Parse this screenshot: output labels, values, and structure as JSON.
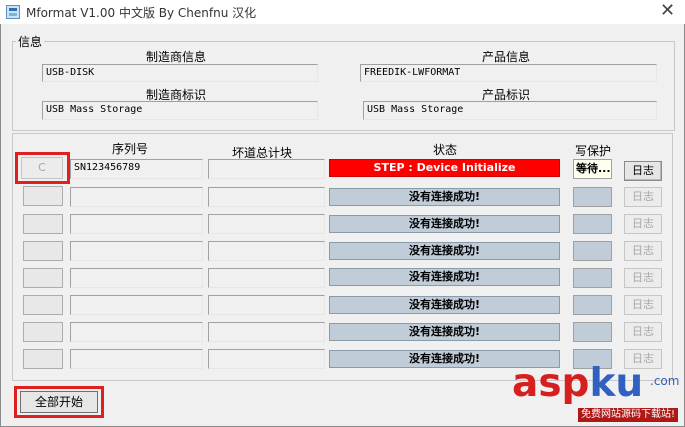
{
  "window": {
    "title": "Mformat V1.00 中文版 By Chenfnu 汉化",
    "close_symbol": "✕"
  },
  "info": {
    "legend": "信息",
    "vendor_info_label": "制造商信息",
    "vendor_info_value": "USB-DISK",
    "product_info_label": "产品信息",
    "product_info_value": "FREEDIK-LWFORMAT",
    "vendor_id_label": "制造商标识",
    "vendor_id_value": "USB Mass Storage",
    "product_id_label": "产品标识",
    "product_id_value": "USB Mass Storage"
  },
  "table": {
    "headers": {
      "serial": "序列号",
      "bad_blocks": "坏道总计块",
      "status": "状态",
      "write_protect": "写保护"
    },
    "rows": [
      {
        "slot": "C",
        "serial": "SN123456789",
        "bad": "",
        "status": "STEP : Device Initialize",
        "wp": "等待...",
        "log": "日志",
        "active": true
      },
      {
        "slot": "",
        "serial": "",
        "bad": "",
        "status": "没有连接成功!",
        "wp": "",
        "log": "日志",
        "active": false
      },
      {
        "slot": "",
        "serial": "",
        "bad": "",
        "status": "没有连接成功!",
        "wp": "",
        "log": "日志",
        "active": false
      },
      {
        "slot": "",
        "serial": "",
        "bad": "",
        "status": "没有连接成功!",
        "wp": "",
        "log": "日志",
        "active": false
      },
      {
        "slot": "",
        "serial": "",
        "bad": "",
        "status": "没有连接成功!",
        "wp": "",
        "log": "日志",
        "active": false
      },
      {
        "slot": "",
        "serial": "",
        "bad": "",
        "status": "没有连接成功!",
        "wp": "",
        "log": "日志",
        "active": false
      },
      {
        "slot": "",
        "serial": "",
        "bad": "",
        "status": "没有连接成功!",
        "wp": "",
        "log": "日志",
        "active": false
      },
      {
        "slot": "",
        "serial": "",
        "bad": "",
        "status": "没有连接成功!",
        "wp": "",
        "log": "日志",
        "active": false
      }
    ]
  },
  "start_all_label": "全部开始",
  "watermark": {
    "part_a": "asp",
    "part_b": "ku",
    "dot_com": ".com",
    "sub": "免费网站源码下载站!"
  },
  "colors": {
    "status_active": "#ff0000",
    "status_idle": "#c0ccd8",
    "highlight_box": "#e02020"
  }
}
